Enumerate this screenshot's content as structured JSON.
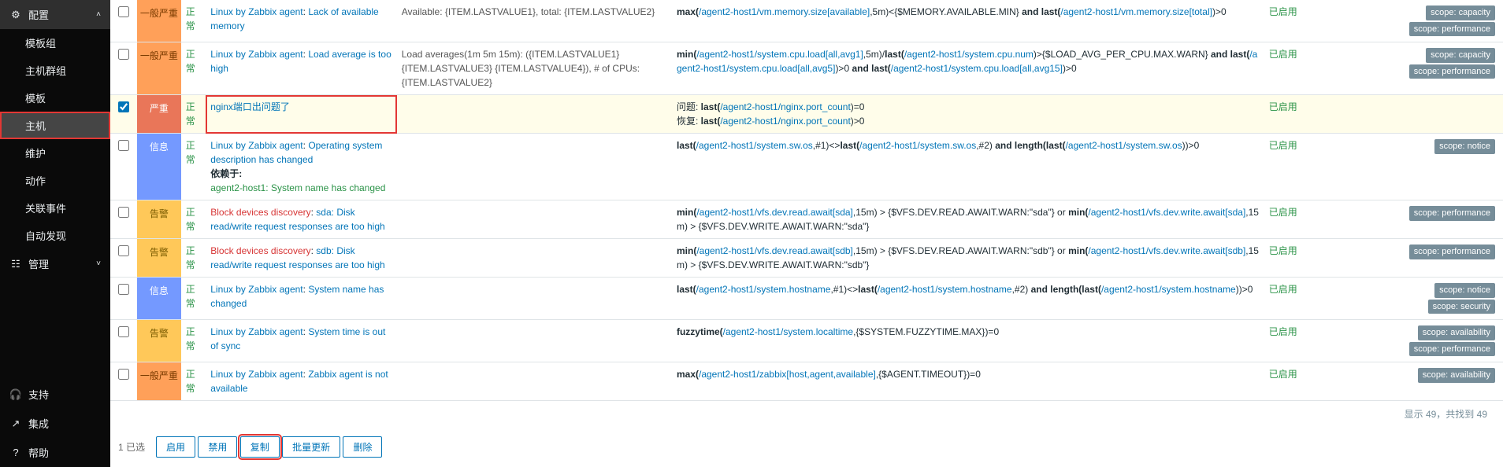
{
  "sidebar": {
    "config": {
      "label": "配置"
    },
    "items": [
      "模板组",
      "主机群组",
      "模板",
      "主机",
      "维护",
      "动作",
      "关联事件",
      "自动发现"
    ],
    "manage": {
      "label": "管理"
    },
    "support": "支持",
    "integration": "集成",
    "help": "帮助"
  },
  "rows": [
    {
      "sev": "一般严重",
      "sevClass": "sev-avg",
      "status": "正常",
      "prefix": "Linux by Zabbix agent",
      "name": "Lack of available memory",
      "opdata": "Available: {ITEM.LASTVALUE1}, total: {ITEM.LASTVALUE2}",
      "expr": [
        {
          "b": "max("
        },
        {
          "l": "/agent2-host1/vm.memory.size[available]"
        },
        {
          "t": ",5m)<{$MEMORY.AVAILABLE.MIN} "
        },
        {
          "b": "and last("
        },
        {
          "l": "/agent2-host1/vm.memory.size[total]"
        },
        {
          "t": ")>0"
        }
      ],
      "enable": "已启用",
      "tags": [
        "scope: capacity",
        "scope: performance"
      ]
    },
    {
      "sev": "一般严重",
      "sevClass": "sev-avg",
      "status": "正常",
      "prefix": "Linux by Zabbix agent",
      "name": "Load average is too high",
      "opdata": "Load averages(1m 5m 15m): ({ITEM.LASTVALUE1} {ITEM.LASTVALUE3} {ITEM.LASTVALUE4}), # of CPUs: {ITEM.LASTVALUE2}",
      "expr": [
        {
          "b": "min("
        },
        {
          "l": "/agent2-host1/system.cpu.load[all,avg1]"
        },
        {
          "t": ",5m)/"
        },
        {
          "b": "last("
        },
        {
          "l": "/agent2-host1/system.cpu.num"
        },
        {
          "t": ")>{$LOAD_AVG_PER_CPU.MAX.WARN} "
        },
        {
          "b": "and last("
        },
        {
          "l": "/agent2-host1/system.cpu.load[all,avg5]"
        },
        {
          "t": ")>0 "
        },
        {
          "b": "and last("
        },
        {
          "l": "/agent2-host1/system.cpu.load[all,avg15]"
        },
        {
          "t": ")>0"
        }
      ],
      "enable": "已启用",
      "tags": [
        "scope: capacity",
        "scope: performance"
      ]
    },
    {
      "selected": true,
      "outlined": true,
      "sev": "严重",
      "sevClass": "sev-high",
      "status": "正常",
      "prefix": "",
      "name": "nginx端口出问题了",
      "opdata": "",
      "expr": [
        {
          "t": "问题: "
        },
        {
          "b": "last("
        },
        {
          "l": "/agent2-host1/nginx.port_count"
        },
        {
          "t": ")=0"
        },
        {
          "br": true
        },
        {
          "t": "恢复: "
        },
        {
          "b": "last("
        },
        {
          "l": "/agent2-host1/nginx.port_count"
        },
        {
          "t": ")>0"
        }
      ],
      "enable": "已启用",
      "tags": []
    },
    {
      "sev": "信息",
      "sevClass": "sev-info",
      "status": "正常",
      "prefix": "Linux by Zabbix agent",
      "name": "Operating system description has changed",
      "depends": "依赖于:",
      "dependsLink": "agent2-host1: System name has changed",
      "opdata": "",
      "expr": [
        {
          "b": "last("
        },
        {
          "l": "/agent2-host1/system.sw.os"
        },
        {
          "t": ",#1)<>"
        },
        {
          "b": "last("
        },
        {
          "l": "/agent2-host1/system.sw.os"
        },
        {
          "t": ",#2) "
        },
        {
          "b": "and length(last("
        },
        {
          "l": "/agent2-host1/system.sw.os"
        },
        {
          "t": "))>0"
        }
      ],
      "enable": "已启用",
      "tags": [
        "scope: notice"
      ]
    },
    {
      "sev": "告警",
      "sevClass": "sev-warn",
      "status": "正常",
      "prefix": "Block devices discovery",
      "prefixRed": true,
      "name": "sda: Disk read/write request responses are too high",
      "opdata": "",
      "expr": [
        {
          "b": "min("
        },
        {
          "l": "/agent2-host1/vfs.dev.read.await[sda]"
        },
        {
          "t": ",15m) > {$VFS.DEV.READ.AWAIT.WARN:\"sda\"} or "
        },
        {
          "b": "min("
        },
        {
          "l": "/agent2-host1/vfs.dev.write.await[sda]"
        },
        {
          "t": ",15m) > {$VFS.DEV.WRITE.AWAIT.WARN:\"sda\"}"
        }
      ],
      "enable": "已启用",
      "tags": [
        "scope: performance"
      ]
    },
    {
      "sev": "告警",
      "sevClass": "sev-warn",
      "status": "正常",
      "prefix": "Block devices discovery",
      "prefixRed": true,
      "name": "sdb: Disk read/write request responses are too high",
      "opdata": "",
      "expr": [
        {
          "b": "min("
        },
        {
          "l": "/agent2-host1/vfs.dev.read.await[sdb]"
        },
        {
          "t": ",15m) > {$VFS.DEV.READ.AWAIT.WARN:\"sdb\"} or "
        },
        {
          "b": "min("
        },
        {
          "l": "/agent2-host1/vfs.dev.write.await[sdb]"
        },
        {
          "t": ",15m) > {$VFS.DEV.WRITE.AWAIT.WARN:\"sdb\"}"
        }
      ],
      "enable": "已启用",
      "tags": [
        "scope: performance"
      ]
    },
    {
      "sev": "信息",
      "sevClass": "sev-info",
      "status": "正常",
      "prefix": "Linux by Zabbix agent",
      "name": "System name has changed",
      "opdata": "",
      "expr": [
        {
          "b": "last("
        },
        {
          "l": "/agent2-host1/system.hostname"
        },
        {
          "t": ",#1)<>"
        },
        {
          "b": "last("
        },
        {
          "l": "/agent2-host1/system.hostname"
        },
        {
          "t": ",#2) "
        },
        {
          "b": "and length(last("
        },
        {
          "l": "/agent2-host1/system.hostname"
        },
        {
          "t": "))>0"
        }
      ],
      "enable": "已启用",
      "tags": [
        "scope: notice",
        "scope: security"
      ]
    },
    {
      "sev": "告警",
      "sevClass": "sev-warn",
      "status": "正常",
      "prefix": "Linux by Zabbix agent",
      "name": "System time is out of sync",
      "opdata": "",
      "expr": [
        {
          "b": "fuzzytime("
        },
        {
          "l": "/agent2-host1/system.localtime"
        },
        {
          "t": ",{$SYSTEM.FUZZYTIME.MAX})=0"
        }
      ],
      "enable": "已启用",
      "tags": [
        "scope: availability",
        "scope: performance"
      ]
    },
    {
      "sev": "一般严重",
      "sevClass": "sev-avg",
      "status": "正常",
      "prefix": "Linux by Zabbix agent",
      "name": "Zabbix agent is not available",
      "opdata": "",
      "expr": [
        {
          "b": "max("
        },
        {
          "l": "/agent2-host1/zabbix[host,agent,available]"
        },
        {
          "t": ",{$AGENT.TIMEOUT})=0"
        }
      ],
      "enable": "已启用",
      "tags": [
        "scope: availability"
      ]
    }
  ],
  "footer": {
    "summary": "显示 49，共找到 49",
    "selected": "1 已选",
    "buttons": [
      "启用",
      "禁用",
      "复制",
      "批量更新",
      "删除"
    ]
  }
}
